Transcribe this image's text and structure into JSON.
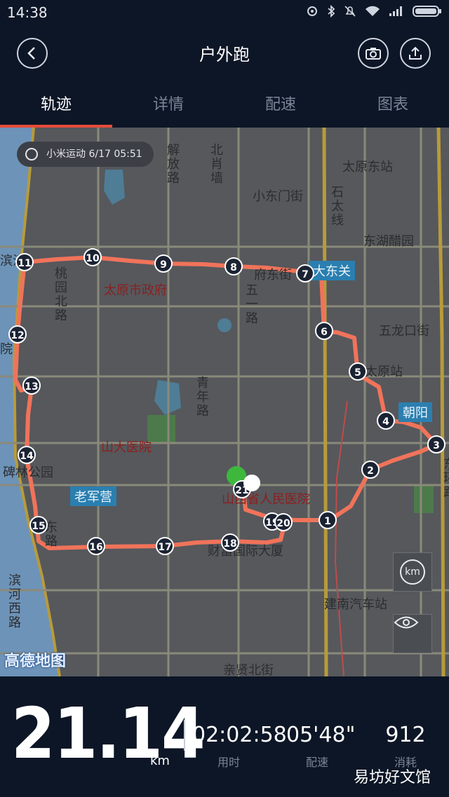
{
  "status_bar": {
    "time": "14:38"
  },
  "header": {
    "title": "户外跑"
  },
  "tabs": [
    {
      "label": "轨迹",
      "active": true
    },
    {
      "label": "详情",
      "active": false
    },
    {
      "label": "配速",
      "active": false
    },
    {
      "label": "图表",
      "active": false
    }
  ],
  "map": {
    "record_pill": "小米运动 6/17 05:51",
    "labels": {
      "taiyuan_east": "太原东站",
      "xiaodongmen": "小东门街",
      "donghu": "东湖醋园",
      "taoyuan_north": "桃园北路",
      "city_gov": "太原市政府",
      "wuyi_road": "五一路",
      "wulongkou": "五龙口街",
      "taiyuan_station": "太原站",
      "chaoyang": "朝阳",
      "dadongguan": "大东关",
      "jiefang_road": "解放路",
      "beisu_wall": "北肖墙",
      "shitai_line": "石太线",
      "shanda_hospital": "山大医院",
      "qingnian_road": "青年路",
      "lao_junying": "老军营",
      "shanxi_hospital": "山西省人民医院",
      "beilin_park": "碑林公园",
      "caimao_building": "财富国际大厦",
      "jiannan_bus": "建南汽车站",
      "qinxian_north": "亲贤北街",
      "binhe_west": "滨河西路",
      "binhe_east": "东路",
      "huan_road": "东环路",
      "fudong_street": "府东街",
      "binjiang_partial": "滨江",
      "yuan": "院"
    },
    "route_markers": [
      "1",
      "2",
      "3",
      "4",
      "5",
      "6",
      "7",
      "8",
      "9",
      "10",
      "11",
      "12",
      "13",
      "14",
      "15",
      "16",
      "17",
      "18",
      "19",
      "20",
      "21"
    ],
    "km_button": "km",
    "logo": "高德地图",
    "route_color": "#f0735a"
  },
  "stats": {
    "distance": "21.14",
    "distance_unit": "km",
    "duration": "02:02:58",
    "duration_label": "用时",
    "pace": "05'48\"",
    "pace_label": "配速",
    "calories": "912",
    "calories_label": "消耗"
  },
  "watermark": "易坊好文馆"
}
